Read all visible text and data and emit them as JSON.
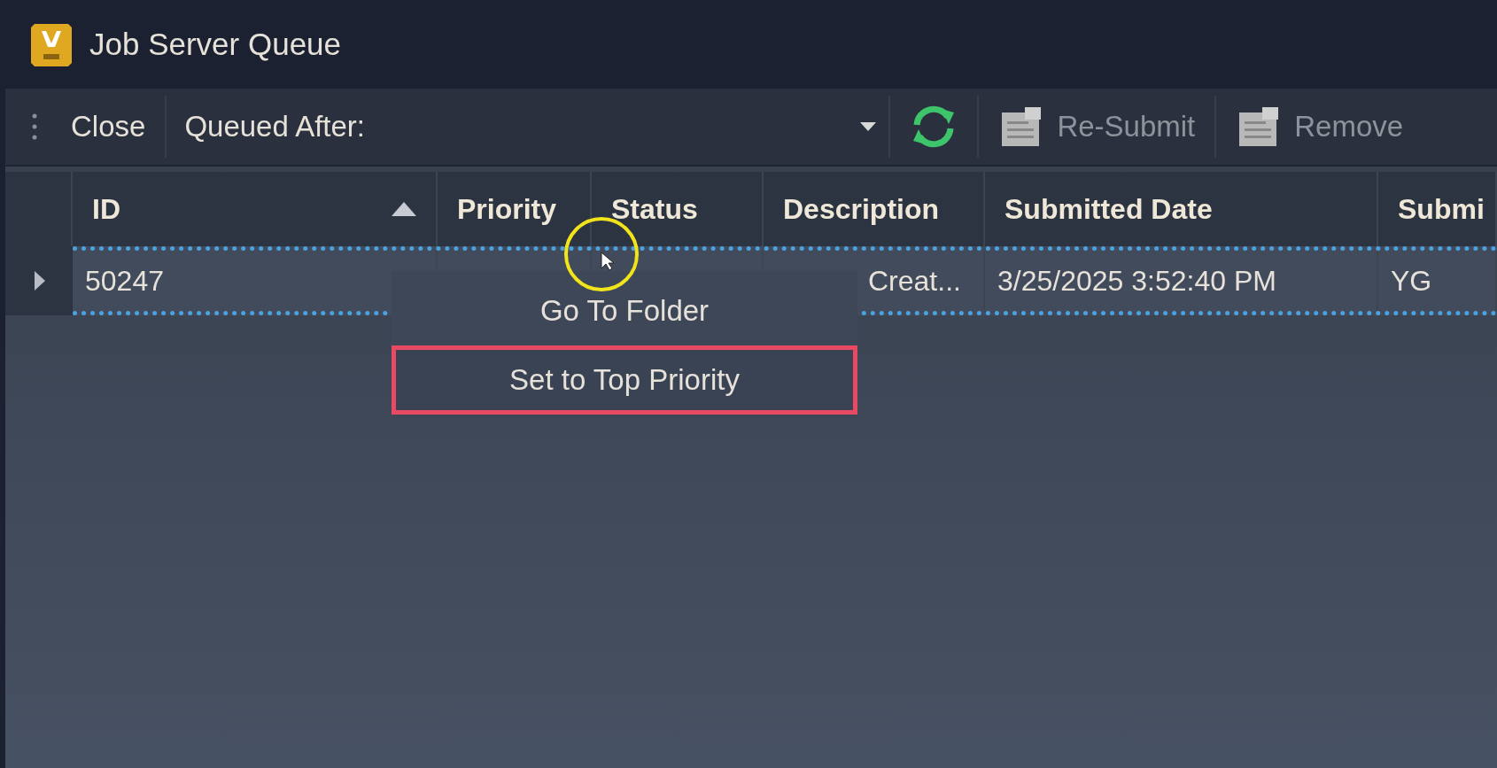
{
  "window": {
    "title": "Job Server Queue"
  },
  "toolbar": {
    "close": "Close",
    "queued_after": "Queued After:",
    "buttons": [
      {
        "label": "Re-Submit",
        "disabled": true
      },
      {
        "label": "Remove",
        "disabled": true
      }
    ]
  },
  "table": {
    "columns": [
      {
        "label": "ID",
        "sort_ascending": true
      },
      {
        "label": "Priority"
      },
      {
        "label": "Status"
      },
      {
        "label": "Description"
      },
      {
        "label": "Submitted Date"
      },
      {
        "label": "Submi"
      }
    ],
    "rows": [
      {
        "selected": true,
        "expanded": false,
        "id": "50247",
        "description": "Creat...",
        "submitted_date": "3/25/2025 3:52:40 PM",
        "column_6": "YG"
      }
    ]
  },
  "context_menu": {
    "items": [
      {
        "label": "Go To Folder",
        "highlighted": false
      },
      {
        "label": "Set to Top Priority",
        "highlighted": true
      }
    ]
  }
}
